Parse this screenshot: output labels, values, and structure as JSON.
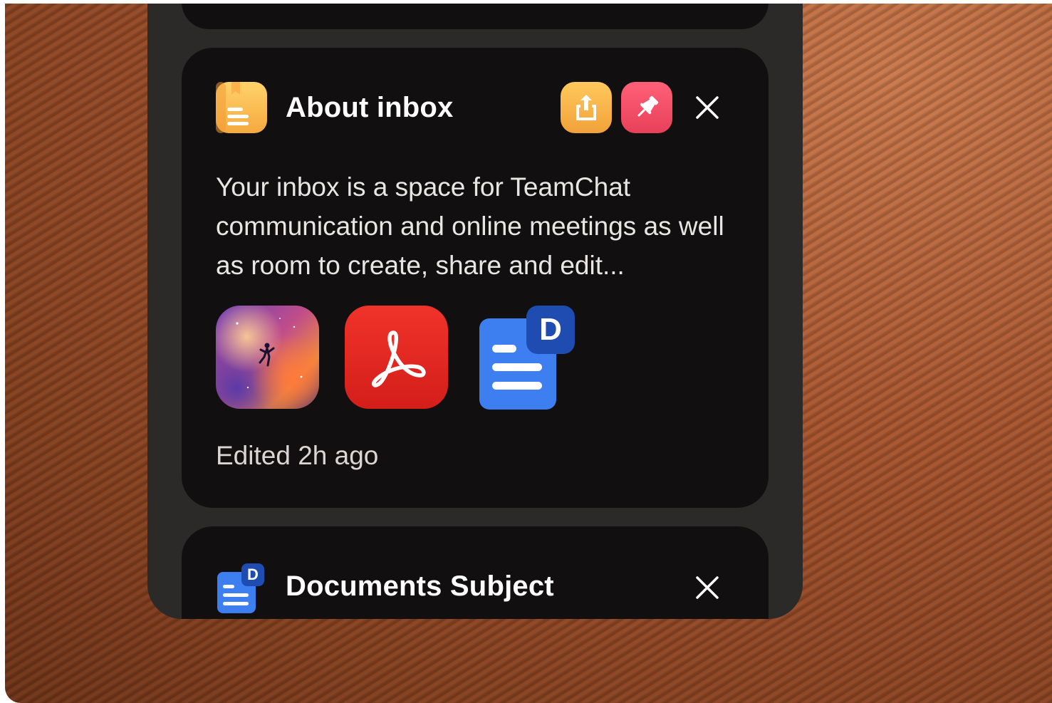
{
  "colors": {
    "panel_bg": "#2c2a29",
    "card_bg": "#110f0f",
    "share_accent": "#f7b24a",
    "pin_accent": "#f04c64",
    "pdf_red": "#e5271f",
    "doc_blue": "#3d7ff0",
    "doc_badge": "#1f4cb0"
  },
  "cards": [
    {
      "title": "About inbox",
      "icon": "notes-icon",
      "description": "Your inbox is a space for TeamChat communication and online meetings as well as room to create, share and edit...",
      "attachments": [
        "space-image-thumbnail",
        "pdf-icon",
        "document-icon"
      ],
      "doc_badge": "D",
      "edited": "Edited 2h ago",
      "actions": [
        "share-icon",
        "pin-icon",
        "close-icon"
      ]
    },
    {
      "title": "Documents Subject",
      "icon": "document-icon",
      "doc_badge": "D",
      "actions": [
        "close-icon"
      ]
    }
  ]
}
